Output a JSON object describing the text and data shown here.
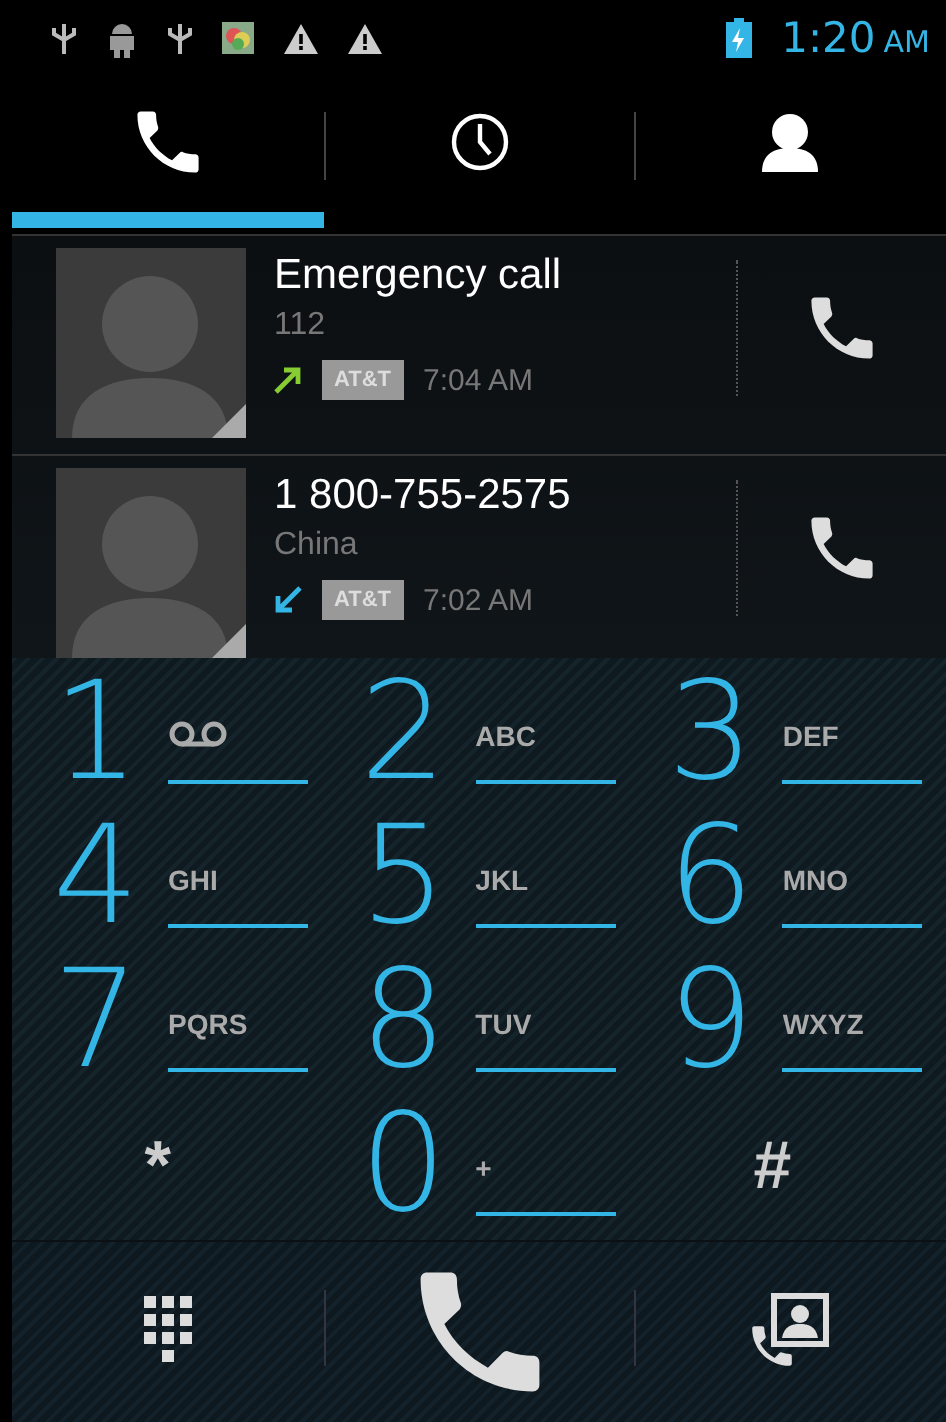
{
  "status_bar": {
    "time": "1:20",
    "meridiem": "AM"
  },
  "tabs": [
    {
      "kind": "dialer",
      "selected": true
    },
    {
      "kind": "recent",
      "selected": false
    },
    {
      "kind": "contacts",
      "selected": false
    }
  ],
  "call_log": [
    {
      "name": "Emergency call",
      "number": "112",
      "kind": "outgoing",
      "carrier": "AT&T",
      "time": "7:04 AM"
    },
    {
      "name": "1 800-755-2575",
      "number": "China",
      "kind": "incoming",
      "carrier": "AT&T",
      "time": "7:02 AM"
    }
  ],
  "dialpad": [
    {
      "kind": "voicemail",
      "digit": "1"
    },
    {
      "kind": "letters",
      "digit": "2",
      "letters": "ABC"
    },
    {
      "kind": "letters",
      "digit": "3",
      "letters": "DEF"
    },
    {
      "kind": "letters",
      "digit": "4",
      "letters": "GHI"
    },
    {
      "kind": "letters",
      "digit": "5",
      "letters": "JKL"
    },
    {
      "kind": "letters",
      "digit": "6",
      "letters": "MNO"
    },
    {
      "kind": "letters",
      "digit": "7",
      "letters": "PQRS"
    },
    {
      "kind": "letters",
      "digit": "8",
      "letters": "TUV"
    },
    {
      "kind": "letters",
      "digit": "9",
      "letters": "WXYZ"
    },
    {
      "kind": "symbol",
      "digit": "*"
    },
    {
      "kind": "letters",
      "digit": "0",
      "letters": "+"
    },
    {
      "kind": "symbol",
      "digit": "#"
    }
  ],
  "bottom_bar": [
    {
      "kind": "dialpad"
    },
    {
      "kind": "call"
    },
    {
      "kind": "contacts"
    }
  ]
}
